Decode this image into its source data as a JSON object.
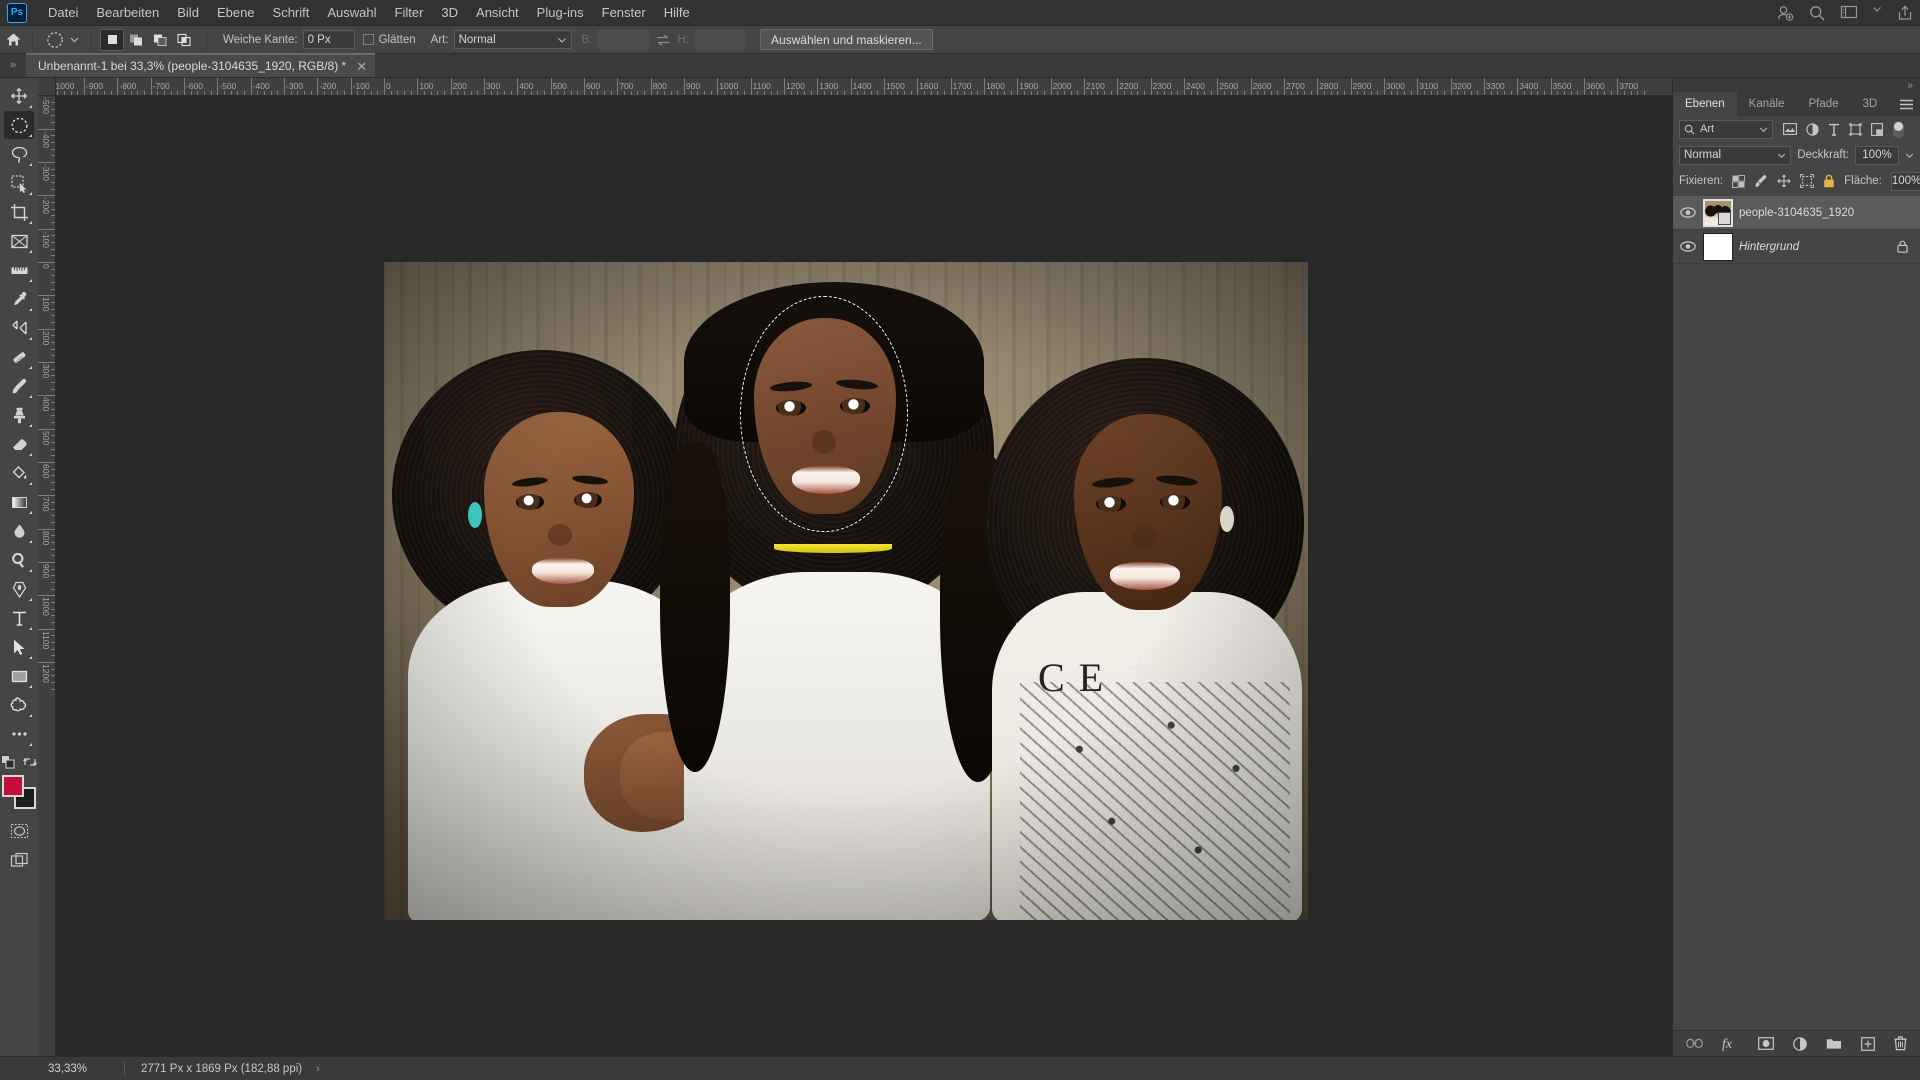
{
  "app": {
    "name": "Adobe Photoshop",
    "logo_text": "Ps"
  },
  "menubar": {
    "items": [
      {
        "label": "Datei"
      },
      {
        "label": "Bearbeiten"
      },
      {
        "label": "Bild"
      },
      {
        "label": "Ebene"
      },
      {
        "label": "Schrift"
      },
      {
        "label": "Auswahl"
      },
      {
        "label": "Filter"
      },
      {
        "label": "3D"
      },
      {
        "label": "Ansicht"
      },
      {
        "label": "Plug-ins"
      },
      {
        "label": "Fenster"
      },
      {
        "label": "Hilfe"
      }
    ],
    "right_icons": [
      {
        "name": "add-user-icon"
      },
      {
        "name": "search-icon"
      },
      {
        "name": "workspace-icon"
      },
      {
        "name": "chevron-down-icon"
      },
      {
        "name": "share-icon"
      }
    ]
  },
  "options_bar": {
    "home_icon": "home-icon",
    "tool_preset": {
      "icon": "elliptical-marquee-icon",
      "chevron": "chevron-down-icon"
    },
    "selection_modes": [
      {
        "name": "new-selection",
        "active": true
      },
      {
        "name": "add-to-selection",
        "active": false
      },
      {
        "name": "subtract-from-selection",
        "active": false
      },
      {
        "name": "intersect-selection",
        "active": false
      }
    ],
    "feather_label": "Weiche Kante:",
    "feather_value": "0 Px",
    "antialias_label": "Glätten",
    "antialias_checked": false,
    "style_label": "Art:",
    "style_value": "Normal",
    "width_label": "B:",
    "width_value": "",
    "height_label": "H:",
    "height_value": "",
    "swap_icon": "swap-dimensions-icon",
    "select_mask_button": "Auswählen und maskieren..."
  },
  "tab_bar": {
    "collapse_icon": "expand-arrows-icon",
    "document": {
      "title": "Unbenannt-1 bei 33,3% (people-3104635_1920, RGB/8) *",
      "close_icon": "close-icon"
    }
  },
  "toolbar": {
    "tools": [
      {
        "name": "move-tool",
        "active": false
      },
      {
        "name": "elliptical-marquee-tool",
        "active": true
      },
      {
        "name": "lasso-tool",
        "active": false
      },
      {
        "name": "quick-selection-tool",
        "active": false
      },
      {
        "name": "crop-tool",
        "active": false
      },
      {
        "name": "frame-tool",
        "active": false
      },
      {
        "name": "ruler-tool",
        "active": false
      },
      {
        "name": "eyedropper-tool",
        "active": false
      },
      {
        "name": "healing-brush-tool",
        "active": false
      },
      {
        "name": "patch-tool",
        "active": false
      },
      {
        "name": "brush-tool",
        "active": false
      },
      {
        "name": "clone-stamp-tool",
        "active": false
      },
      {
        "name": "eraser-tool",
        "active": false
      },
      {
        "name": "paint-bucket-tool",
        "active": false
      },
      {
        "name": "gradient-tool",
        "active": false
      },
      {
        "name": "blur-tool",
        "active": false
      },
      {
        "name": "dodge-tool",
        "active": false
      },
      {
        "name": "pen-tool",
        "active": false
      },
      {
        "name": "type-tool",
        "active": false
      },
      {
        "name": "path-selection-tool",
        "active": false
      },
      {
        "name": "rectangle-tool",
        "active": false
      },
      {
        "name": "custom-shape-tool",
        "active": false
      },
      {
        "name": "more-tools",
        "active": false
      }
    ],
    "colors": {
      "foreground": "#c30f3c",
      "background": "#1d1d1d",
      "default_colors_icon": "default-colors-icon",
      "swap_colors_icon": "swap-colors-icon"
    },
    "quick_mask_icon": "quick-mask-icon",
    "screen_mode_icon": "screen-mode-icon"
  },
  "rulers": {
    "unit": "Px",
    "horizontal_labels": [
      "-1000",
      "-900",
      "-800",
      "-700",
      "-600",
      "-500",
      "-400",
      "-300",
      "-200",
      "-100",
      "0",
      "100",
      "200",
      "300",
      "400",
      "500",
      "600",
      "700",
      "800",
      "900",
      "1000",
      "1100",
      "1200",
      "1300",
      "1400",
      "1500",
      "1600",
      "1700",
      "1800",
      "1900",
      "2000",
      "2100",
      "2200",
      "2300",
      "2400",
      "2500",
      "2600",
      "2700",
      "2800",
      "2900",
      "3000",
      "3100",
      "3200",
      "3300",
      "3400",
      "3500",
      "3600",
      "3700"
    ],
    "vertical_labels": [
      "-500",
      "-400",
      "-300",
      "-200",
      "-100",
      "0",
      "100",
      "200",
      "300",
      "400",
      "500",
      "600",
      "700",
      "800",
      "900",
      "1000",
      "1100",
      "1200"
    ]
  },
  "canvas": {
    "image_name": "people-3104635_1920",
    "selection": {
      "type": "ellipse",
      "label": "elliptical-marquee-selection"
    },
    "cursor": "crosshair-cursor"
  },
  "panels": {
    "collapse_icon": "collapse-panels-icon",
    "tabs": [
      {
        "label": "Ebenen",
        "active": true
      },
      {
        "label": "Kanäle",
        "active": false
      },
      {
        "label": "Pfade",
        "active": false
      },
      {
        "label": "3D",
        "active": false
      }
    ],
    "menu_icon": "panel-menu-icon",
    "filter": {
      "search_icon": "search-icon",
      "value": "Art",
      "chevron": "chevron-down-icon",
      "type_icons": [
        {
          "name": "filter-pixel-icon"
        },
        {
          "name": "filter-adjustment-icon"
        },
        {
          "name": "filter-type-icon"
        },
        {
          "name": "filter-shape-icon"
        },
        {
          "name": "filter-smart-object-icon"
        }
      ],
      "toggle_name": "filter-toggle"
    },
    "blend": {
      "mode": "Normal",
      "chevron": "chevron-down-icon",
      "opacity_label": "Deckkraft:",
      "opacity_value": "100%"
    },
    "lock": {
      "label": "Fixieren:",
      "icons": [
        {
          "name": "lock-transparent-pixels-icon"
        },
        {
          "name": "lock-image-pixels-icon"
        },
        {
          "name": "lock-position-icon"
        },
        {
          "name": "lock-artboard-icon"
        },
        {
          "name": "lock-all-icon"
        }
      ],
      "fill_label": "Fläche:",
      "fill_value": "100%"
    },
    "layers": [
      {
        "name": "people-3104635_1920",
        "visible": true,
        "selected": true,
        "italic": false,
        "locked": false,
        "smart_object": true
      },
      {
        "name": "Hintergrund",
        "visible": true,
        "selected": false,
        "italic": true,
        "locked": true,
        "smart_object": false
      }
    ],
    "bottom_icons": [
      {
        "name": "link-layers-icon"
      },
      {
        "name": "layer-style-fx-icon"
      },
      {
        "name": "add-layer-mask-icon"
      },
      {
        "name": "new-adjustment-layer-icon"
      },
      {
        "name": "new-group-icon"
      },
      {
        "name": "new-layer-icon"
      },
      {
        "name": "delete-layer-icon"
      }
    ]
  },
  "status_bar": {
    "zoom": "33,33%",
    "document_size": "2771 Px x 1869 Px (182,88 ppi)",
    "arrow_icon": "chevron-right-icon"
  },
  "theme": {
    "bg_dark": "#323232",
    "bg_panel": "#454545",
    "bg_canvas": "#282828",
    "accent_blue": "#31a8ff",
    "text": "#c6c6c6"
  }
}
